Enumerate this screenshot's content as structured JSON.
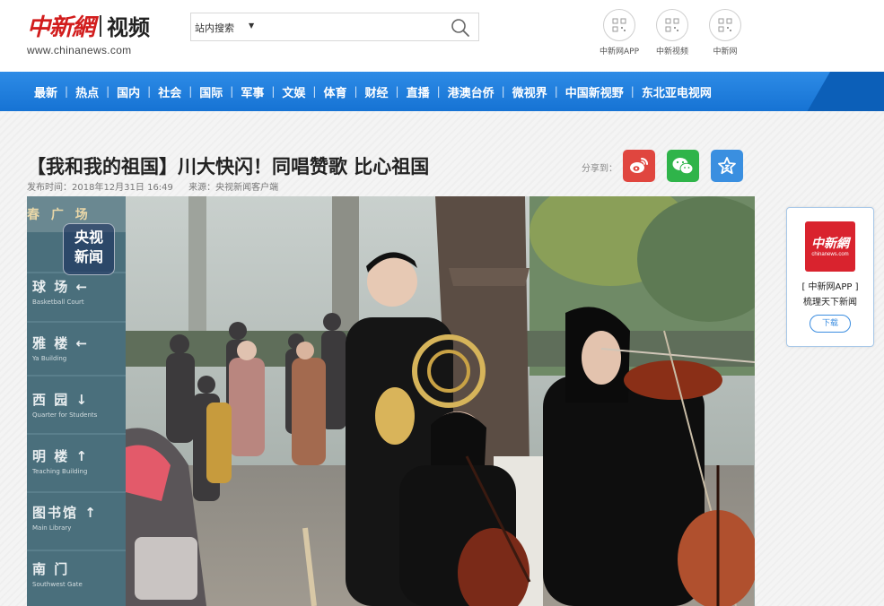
{
  "header": {
    "logo_cn": "中新網",
    "logo_video": "视频",
    "logo_url": "www.chinanews.com",
    "search": {
      "scope": "站内搜索",
      "placeholder": ""
    },
    "qr": [
      {
        "label": "中新网APP",
        "icon": "qr-code-icon"
      },
      {
        "label": "中新视频",
        "icon": "qr-code-icon"
      },
      {
        "label": "中新网",
        "icon": "qr-code-icon"
      }
    ]
  },
  "nav": {
    "items": [
      "最新",
      "热点",
      "国内",
      "社会",
      "国际",
      "军事",
      "文娱",
      "体育",
      "财经",
      "直播",
      "港澳台侨",
      "微视界",
      "中国新视野",
      "东北亚电视网"
    ],
    "separator": "|"
  },
  "article": {
    "title": "【我和我的祖国】川大快闪！同唱赞歌 比心祖国",
    "publish_time": "发布时间：2018年12月31日 16:49",
    "source": "来源：央视新闻客户端",
    "share_label": "分享到："
  },
  "video": {
    "watermark_line1": "央视",
    "watermark_line2": "新闻",
    "sign_top": "春 广 场",
    "signs": [
      {
        "cn": "球  场 ←",
        "en": "Basketball Court"
      },
      {
        "cn": "雅  楼 ←",
        "en": "Ya Building"
      },
      {
        "cn": "西 园 ↓",
        "en": "Quarter for Students"
      },
      {
        "cn": "明  楼 ↑",
        "en": "Teaching Building"
      },
      {
        "cn": "图书馆 ↑",
        "en": "Main Library"
      },
      {
        "cn": "南  门",
        "en": "Southwest Gate"
      }
    ]
  },
  "app_card": {
    "logo_cn": "中新網",
    "logo_en": "chinanews.com",
    "title": "[ 中新网APP ]",
    "subtitle": "梳理天下新闻",
    "download": "下载"
  },
  "colors": {
    "brand_red": "#d21d1d",
    "nav_blue": "#1a7ad8",
    "weibo": "#e0463f",
    "wechat": "#2fb44a",
    "favorite": "#3a8fe0"
  }
}
